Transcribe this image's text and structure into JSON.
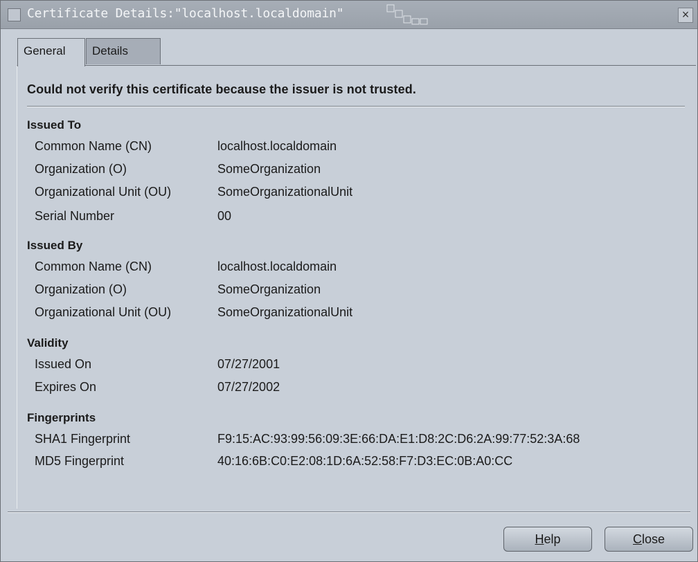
{
  "window": {
    "title": "Certificate Details:\"localhost.localdomain\"",
    "close_glyph": "×"
  },
  "tabs": [
    {
      "label": "General",
      "active": true
    },
    {
      "label": "Details",
      "active": false
    }
  ],
  "headline": "Could not verify this certificate because the issuer is not trusted.",
  "sections": {
    "issued_to": {
      "title": "Issued To",
      "rows": [
        {
          "label": "Common Name (CN)",
          "value": "localhost.localdomain"
        },
        {
          "label": "Organization (O)",
          "value": "SomeOrganization"
        },
        {
          "label": "Organizational Unit (OU)",
          "value": "SomeOrganizationalUnit"
        },
        {
          "label": "Serial Number",
          "value": "00"
        }
      ]
    },
    "issued_by": {
      "title": "Issued By",
      "rows": [
        {
          "label": "Common Name (CN)",
          "value": "localhost.localdomain"
        },
        {
          "label": "Organization (O)",
          "value": "SomeOrganization"
        },
        {
          "label": "Organizational Unit (OU)",
          "value": "SomeOrganizationalUnit"
        }
      ]
    },
    "validity": {
      "title": "Validity",
      "rows": [
        {
          "label": "Issued On",
          "value": "07/27/2001"
        },
        {
          "label": "Expires On",
          "value": "07/27/2002"
        }
      ]
    },
    "fingerprints": {
      "title": "Fingerprints",
      "rows": [
        {
          "label": "SHA1 Fingerprint",
          "value": "F9:15:AC:93:99:56:09:3E:66:DA:E1:D8:2C:D6:2A:99:77:52:3A:68"
        },
        {
          "label": "MD5 Fingerprint",
          "value": "40:16:6B:C0:E2:08:1D:6A:52:58:F7:D3:EC:0B:A0:CC"
        }
      ]
    }
  },
  "buttons": {
    "help": {
      "mnemonic": "H",
      "rest": "elp"
    },
    "close": {
      "mnemonic": "C",
      "rest": "lose"
    }
  },
  "colors": {
    "background": "#c8cfd8",
    "titlebar": "#9aa1aa",
    "inactive_tab": "#a6adb7"
  }
}
